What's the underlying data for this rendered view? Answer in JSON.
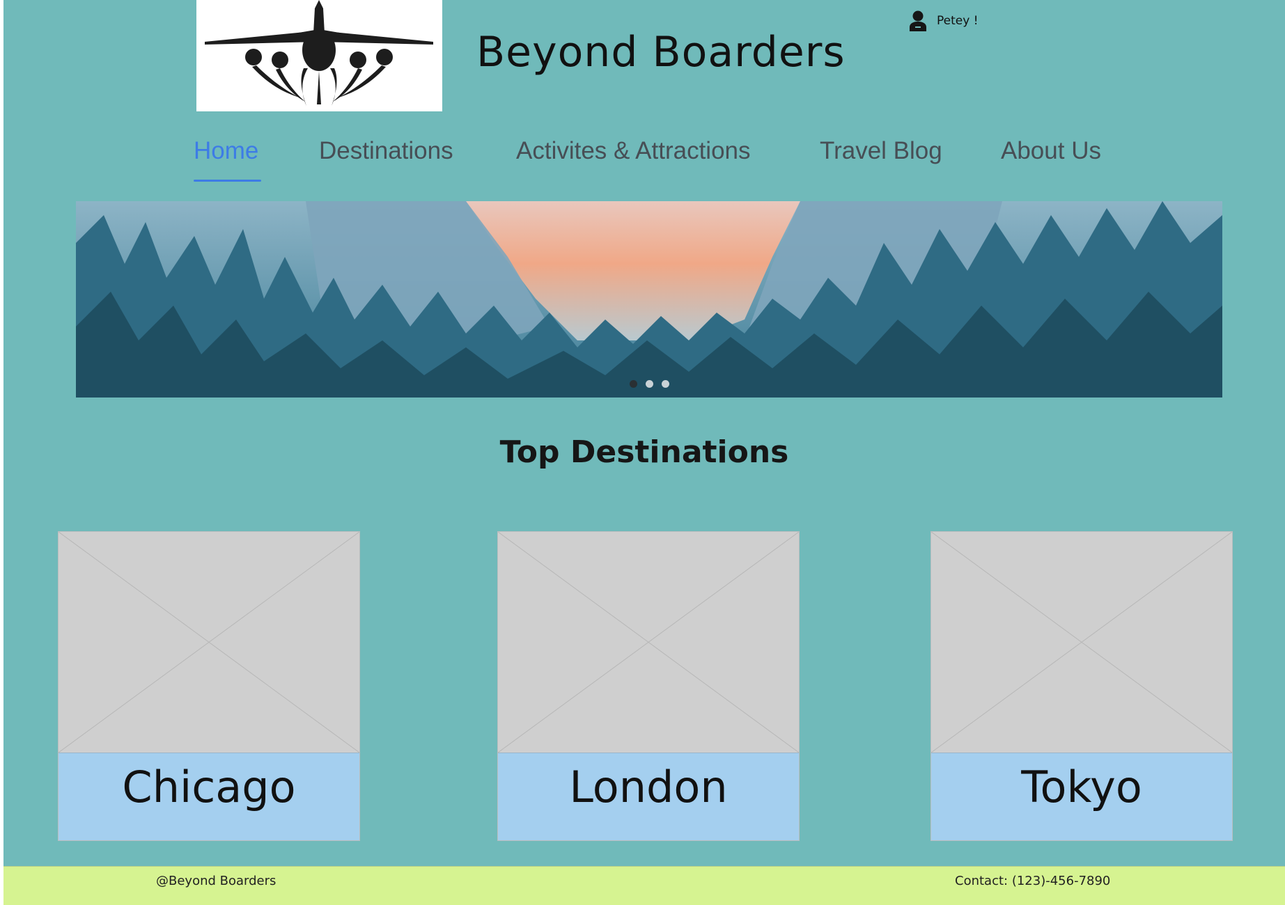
{
  "header": {
    "site_title": "Beyond Boarders",
    "logo_icon": "airplane-icon",
    "user": {
      "name": "Petey !",
      "icon": "user-icon"
    }
  },
  "nav": {
    "items": [
      {
        "label": "Home",
        "active": true
      },
      {
        "label": "Destinations",
        "active": false
      },
      {
        "label": "Activites & Attractions",
        "active": false
      },
      {
        "label": "Travel Blog",
        "active": false
      },
      {
        "label": "About Us",
        "active": false
      }
    ]
  },
  "hero": {
    "slide_count": 3,
    "active_slide": 1
  },
  "main": {
    "section_title": "Top Destinations",
    "destinations": [
      {
        "name": "Chicago"
      },
      {
        "name": "London"
      },
      {
        "name": "Tokyo"
      }
    ]
  },
  "footer": {
    "left": "@Beyond Boarders",
    "right": "Contact: (123)-456-7890"
  },
  "colors": {
    "page_bg": "#70baba",
    "nav_active": "#3d7ce6",
    "caption_bg": "#a4cfef",
    "footer_bg": "#d6f391"
  }
}
